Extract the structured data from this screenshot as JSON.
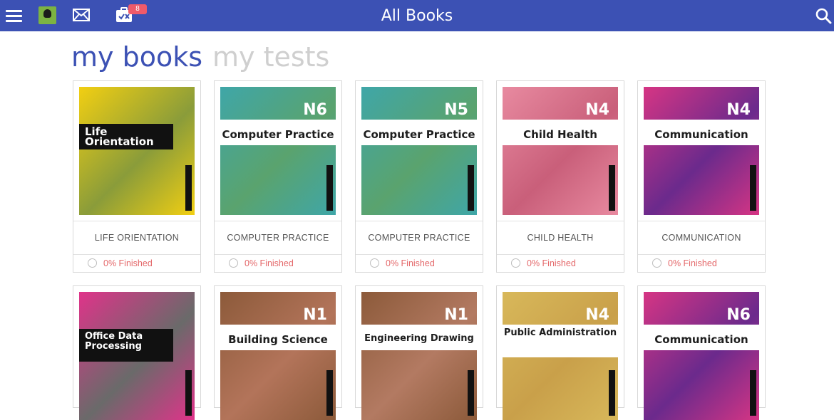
{
  "header": {
    "title": "All Books",
    "tests_badge": "8",
    "bg": "#3c51b4"
  },
  "icons": {
    "menu": "hamburger-icon",
    "app": "app-logo-icon",
    "mail": "mail-icon",
    "tests": "tests-icon",
    "search": "search-icon"
  },
  "tabs": [
    {
      "label": "my books",
      "active": true
    },
    {
      "label": "my tests",
      "active": false
    }
  ],
  "books": [
    {
      "name": "LIFE ORIENTATION",
      "status": "0% Finished",
      "cover_title": "Life Orientation",
      "level": "",
      "cover_bg": "#f2cf12",
      "accent": "#8a9c3a"
    },
    {
      "name": "COMPUTER PRACTICE",
      "status": "0% Finished",
      "cover_title": "Computer Practice",
      "level": "N6",
      "cover_bg": "#3fa6a8",
      "accent": "#5aa36e"
    },
    {
      "name": "COMPUTER PRACTICE",
      "status": "0% Finished",
      "cover_title": "Computer Practice",
      "level": "N5",
      "cover_bg": "#3fa6a8",
      "accent": "#5aa36e"
    },
    {
      "name": "CHILD HEALTH",
      "status": "0% Finished",
      "cover_title": "Child Health",
      "level": "N4",
      "cover_bg": "#e88aa0",
      "accent": "#c95f7a"
    },
    {
      "name": "COMMUNICATION",
      "status": "0% Finished",
      "cover_title": "Communication",
      "level": "N4",
      "cover_bg": "#d63584",
      "accent": "#6b2a8c"
    },
    {
      "name": "",
      "status": "",
      "cover_title": "Office Data Processing",
      "level": "",
      "cover_bg": "#e0338a",
      "accent": "#6a6a6a"
    },
    {
      "name": "",
      "status": "",
      "cover_title": "Building Science",
      "level": "N1",
      "cover_bg": "#8c5a3a",
      "accent": "#b3745a"
    },
    {
      "name": "",
      "status": "",
      "cover_title": "Engineering Drawing",
      "level": "N1",
      "cover_bg": "#8c5a3a",
      "accent": "#b37a62"
    },
    {
      "name": "",
      "status": "",
      "cover_title": "Public Administration",
      "level": "N4",
      "cover_bg": "#d8b85a",
      "accent": "#c9a04a"
    },
    {
      "name": "",
      "status": "",
      "cover_title": "Communication",
      "level": "N6",
      "cover_bg": "#d63584",
      "accent": "#6b2a8c"
    }
  ]
}
